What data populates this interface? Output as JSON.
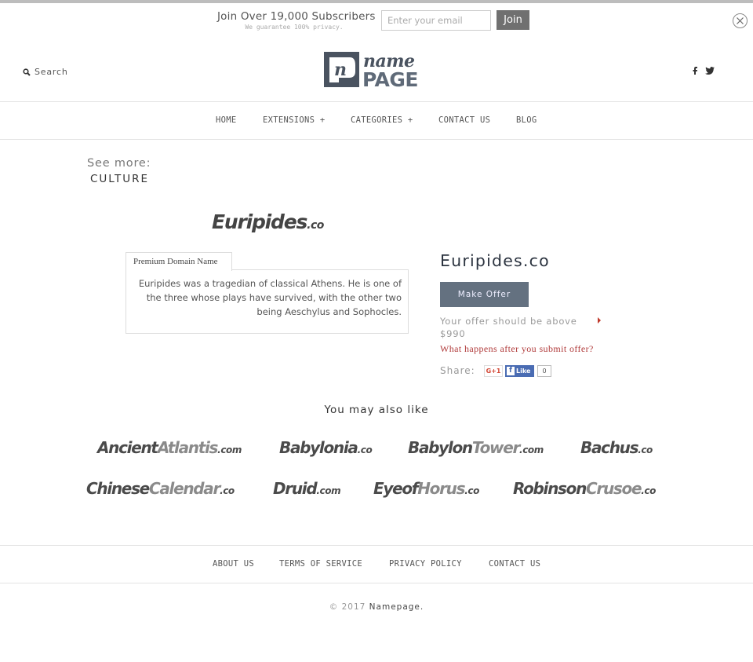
{
  "subscribe": {
    "title": "Join Over 19,000 Subscribers",
    "note": "We guarantee 100% privacy.",
    "email_placeholder": "Enter your email",
    "email_value": "",
    "join_label": "Join",
    "close_icon": "close-circle-icon"
  },
  "header": {
    "search_label": "Search",
    "search_icon": "search-icon",
    "logo": {
      "top": "name",
      "bottom": "PAGE",
      "mark": "n"
    },
    "social": [
      "facebook-icon",
      "twitter-icon"
    ]
  },
  "nav": {
    "items": [
      {
        "label": "HOME"
      },
      {
        "label": "EXTENSIONS +"
      },
      {
        "label": "CATEGORIES +"
      },
      {
        "label": "CONTACT US"
      },
      {
        "label": "BLOG"
      }
    ]
  },
  "see_more": {
    "label": "See more:",
    "category": "CULTURE"
  },
  "domain": {
    "logo_name": "Euripides",
    "logo_tld": ".co",
    "tab_label": "Premium Domain Name",
    "description": "Euripides was a tragedian of classical Athens. He is one of the three whose plays have survived, with the other two being Aeschylus and Sophocles.",
    "title": "Euripides.co",
    "make_offer_label": "Make Offer",
    "offer_note": "Your offer should be above",
    "offer_price": "$990",
    "offer_help_link": "What happens after you submit offer?",
    "share_label": "Share:",
    "gplus_label": "G+1",
    "fb_like_label": "Like",
    "fb_like_count": "0"
  },
  "also_like": {
    "heading": "You may also like",
    "items": [
      {
        "a": "Ancient",
        "b": "Atlantis",
        "tld": ".com"
      },
      {
        "a": "Babylonia",
        "b": "",
        "tld": ".co"
      },
      {
        "a": "Babylon",
        "b": "Tower",
        "tld": ".com"
      },
      {
        "a": "Bachus",
        "b": "",
        "tld": ".co"
      },
      {
        "a": "Chinese",
        "b": "Calendar",
        "tld": ".co"
      },
      {
        "a": "Druid",
        "b": "",
        "tld": ".com"
      },
      {
        "a": "Eyeof",
        "b": "Horus",
        "tld": ".co"
      },
      {
        "a": "Robinson",
        "b": "Crusoe",
        "tld": ".co"
      }
    ]
  },
  "footer": {
    "items": [
      {
        "label": "ABOUT US"
      },
      {
        "label": "TERMS OF SERVICE"
      },
      {
        "label": "PRIVACY POLICY"
      },
      {
        "label": "CONTACT US"
      }
    ],
    "copyright_prefix": "© 2017",
    "copyright_brand": "Namepage."
  },
  "colors": {
    "offer_button": "#647180",
    "link_red": "#b03a3a",
    "join_button": "#707070"
  }
}
